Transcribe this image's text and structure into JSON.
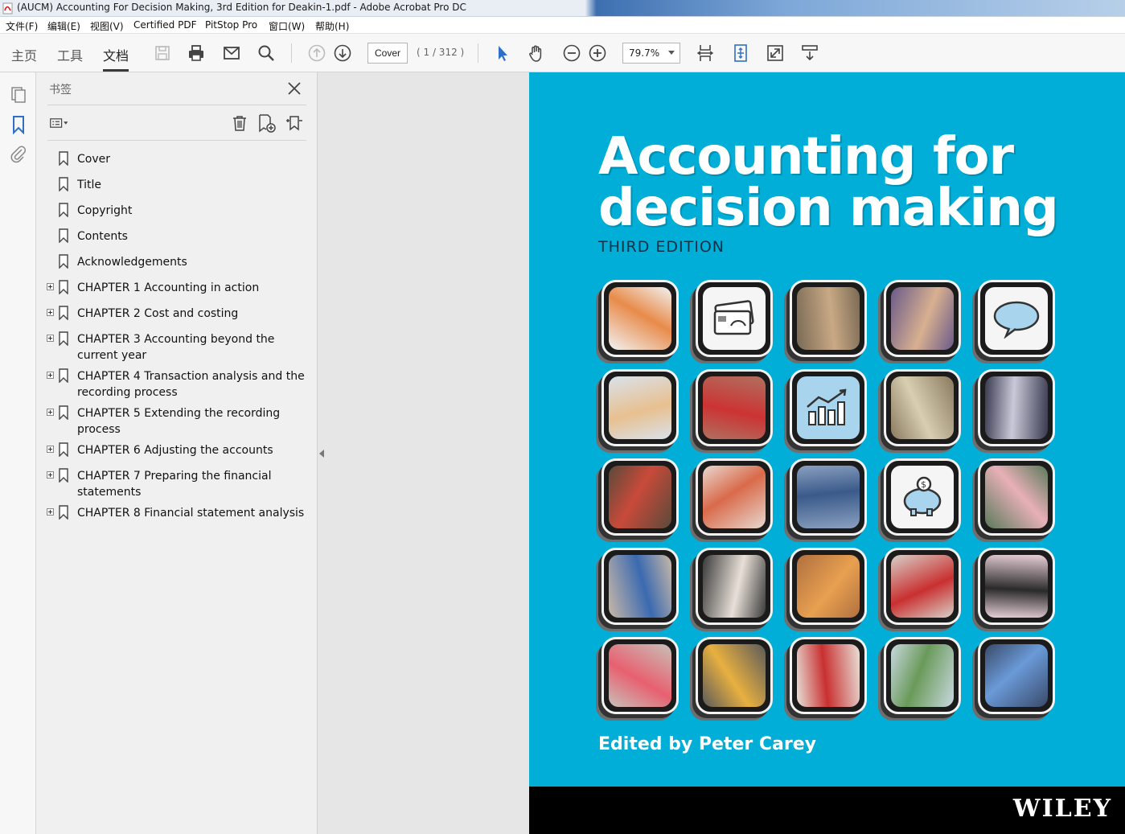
{
  "window": {
    "title": "(AUCM) Accounting For Decision Making, 3rd Edition for Deakin-1.pdf - Adobe Acrobat Pro DC"
  },
  "menu": {
    "items": [
      "文件(F)",
      "编辑(E)",
      "视图(V)",
      "Certified PDF",
      "PitStop Pro",
      "窗口(W)",
      "帮助(H)"
    ]
  },
  "toolbar": {
    "tabs": [
      "主页",
      "工具",
      "文档"
    ],
    "active_tab": "文档",
    "page_input": "Cover",
    "page_count": "( 1 / 312 )",
    "zoom": "79.7%",
    "icons": [
      "save-icon",
      "print-icon",
      "mail-icon",
      "search-icon",
      "page-up-icon",
      "page-down-icon",
      "select-cursor-icon",
      "hand-icon",
      "zoom-out-icon",
      "zoom-in-icon",
      "fit-width-icon",
      "fit-page-icon",
      "full-screen-icon",
      "read-mode-icon"
    ]
  },
  "bookmarks_panel": {
    "title": "书签",
    "items": [
      {
        "label": "Cover",
        "expandable": false
      },
      {
        "label": "Title",
        "expandable": false
      },
      {
        "label": "Copyright",
        "expandable": false
      },
      {
        "label": "Contents",
        "expandable": false
      },
      {
        "label": "Acknowledgements",
        "expandable": false
      },
      {
        "label": "CHAPTER 1 Accounting in action",
        "expandable": true
      },
      {
        "label": "CHAPTER 2 Cost and costing",
        "expandable": true
      },
      {
        "label": "CHAPTER 3 Accounting beyond the current year",
        "expandable": true
      },
      {
        "label": "CHAPTER 4 Transaction analysis and the recording process",
        "expandable": true
      },
      {
        "label": "CHAPTER 5 Extending the recording process",
        "expandable": true
      },
      {
        "label": "CHAPTER 6 Adjusting the accounts",
        "expandable": true
      },
      {
        "label": "CHAPTER 7 Preparing the financial statements",
        "expandable": true
      },
      {
        "label": "CHAPTER 8 Financial statement analysis",
        "expandable": true
      }
    ]
  },
  "cover": {
    "title_line1": "Accounting for",
    "title_line2": "decision making",
    "edition": "THIRD EDITION",
    "editor": "Edited by Peter Carey",
    "publisher": "WILEY",
    "background_color": "#00aed8"
  }
}
